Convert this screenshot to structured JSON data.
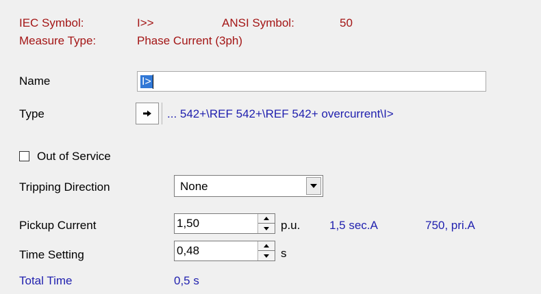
{
  "header": {
    "iec_symbol_label": "IEC Symbol:",
    "iec_symbol_value": "I>>",
    "ansi_symbol_label": "ANSI Symbol:",
    "ansi_symbol_value": "50",
    "measure_type_label": "Measure Type:",
    "measure_type_value": "Phase Current (3ph)"
  },
  "name_field": {
    "label": "Name",
    "value": "I>"
  },
  "type_field": {
    "label": "Type",
    "button_icon": "right-arrow-icon",
    "value": "... 542+\\REF 542+\\REF 542+ overcurrent\\I>"
  },
  "out_of_service": {
    "label": "Out of Service",
    "checked": false
  },
  "tripping_direction": {
    "label": "Tripping Direction",
    "selected": "None"
  },
  "pickup_current": {
    "label": "Pickup Current",
    "value": "1,50",
    "unit": "p.u.",
    "secondary": "1,5 sec.A",
    "primary": "750, pri.A"
  },
  "time_setting": {
    "label": "Time Setting",
    "value": "0,48",
    "unit": "s"
  },
  "total_time": {
    "label": "Total Time",
    "value": "0,5 s"
  },
  "colors": {
    "header_text": "#a31515",
    "link_text": "#1f1fae",
    "selection": "#3178d6",
    "background": "#f0f0f0"
  }
}
